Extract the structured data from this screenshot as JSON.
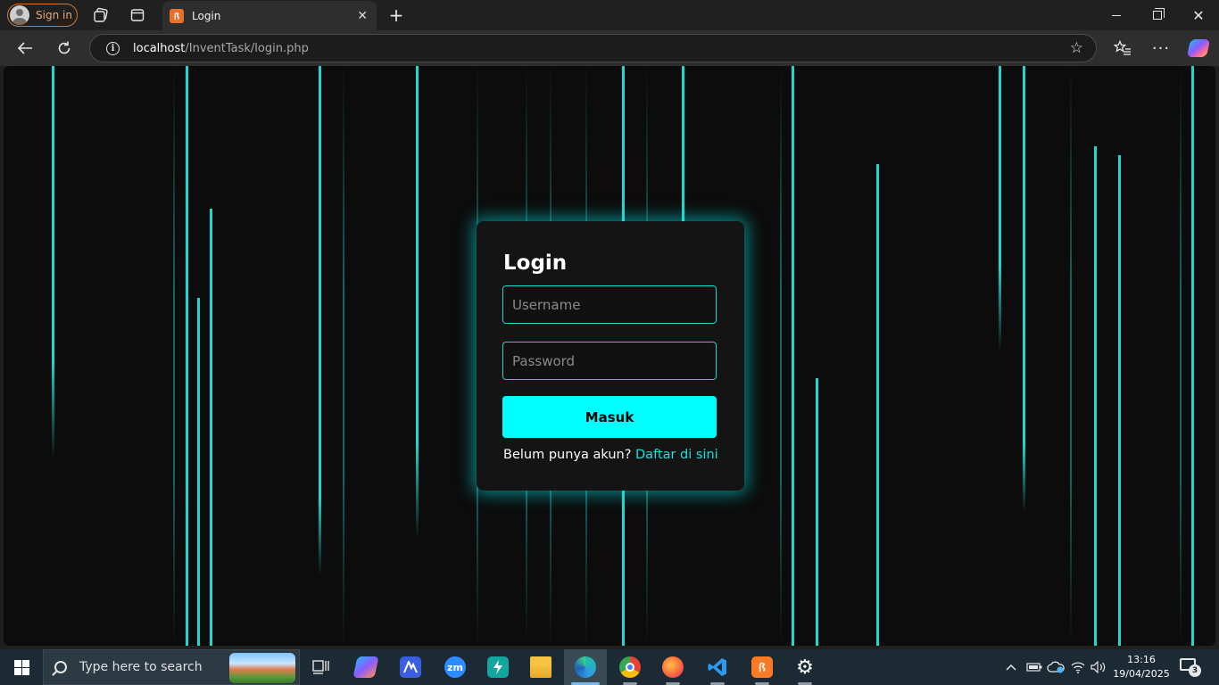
{
  "browser": {
    "signin_label": "Sign in",
    "tab_title": "Login",
    "tab_favicon_glyph": "ꟗ",
    "url_host": "localhost",
    "url_path": "/InventTask/login.php"
  },
  "login": {
    "heading": "Login",
    "username_placeholder": "Username",
    "password_placeholder": "Password",
    "submit_label": "Masuk",
    "register_prompt": "Belum punya akun?",
    "register_link": "Daftar di sini",
    "accent_color": "#00ffff",
    "background_color": "#0c0c0c"
  },
  "taskbar": {
    "search_placeholder": "Type here to search",
    "zoom_label": "zm",
    "time": "13:16",
    "date": "19/04/2025",
    "notification_count": "3",
    "apps": [
      "task-view-icon",
      "copilot-icon",
      "app-icon",
      "zoom-icon",
      "power-automate-icon",
      "file-explorer-icon",
      "edge-icon",
      "chrome-icon",
      "firefox-icon",
      "vscode-icon",
      "xampp-icon",
      "settings-icon"
    ]
  }
}
